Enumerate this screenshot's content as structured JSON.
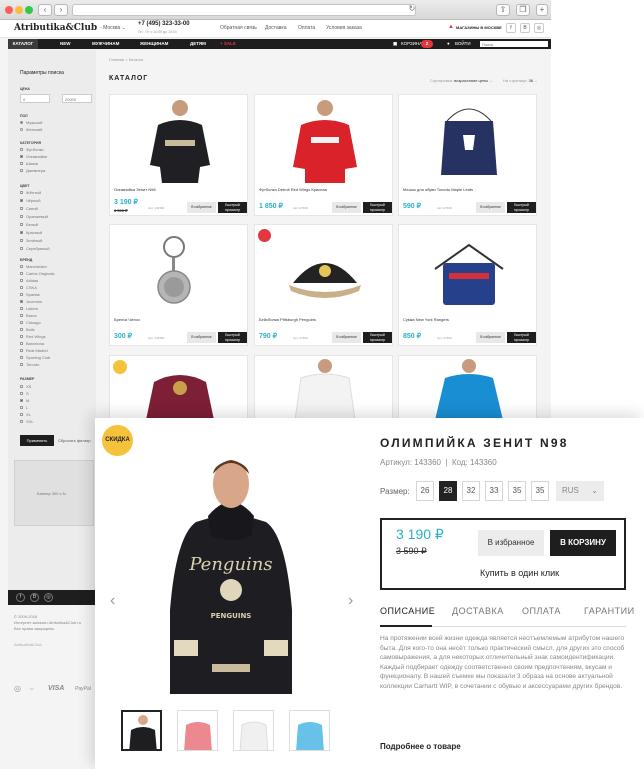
{
  "browser": {
    "address": ""
  },
  "header": {
    "logo": "Atributika&Club",
    "city": "Москва",
    "phone": "+7 (495) 323-33-00",
    "hours": "Пн - Пт с 10:00 до 19:00",
    "links": [
      "Обратная связь",
      "Доставка",
      "Оплата",
      "Условия заказа"
    ],
    "stores": "МАГАЗИНЫ В МОСКВЕ"
  },
  "nav": {
    "items": [
      "КАТАЛОГ",
      "NEW",
      "МУЖЧИНАМ",
      "ЖЕНЩИНАМ",
      "ДЕТЯМ",
      "SALE"
    ],
    "cart_label": "Корзина",
    "cart_count": "2",
    "login": "Войти",
    "search_placeholder": "Поиск"
  },
  "sidebar": {
    "title": "Параметры поиска",
    "price_label": "Цена",
    "price_from": "0",
    "price_to": "20000",
    "sections": [
      {
        "name": "Пол",
        "options": [
          "Мужской",
          "Женский"
        ]
      },
      {
        "name": "Категория",
        "options": [
          "Футболки",
          "Олимпийки",
          "Шапки",
          "Джемпера"
        ]
      },
      {
        "name": "Цвет",
        "options": [
          "Жёлтый",
          "Чёрный",
          "Синий",
          "Оранжевый",
          "Белый",
          "Красный",
          "Зелёный",
          "Серебряный"
        ]
      },
      {
        "name": "Бренд",
        "options": [
          "Manchester",
          "Carlos Originals",
          "Adidas",
          "CSKA",
          "Spartak",
          "Juventus",
          "Lakers",
          "Barca",
          "Chicago",
          "Bulls",
          "Red Wings",
          "Barcelona",
          "Real Madrid",
          "Sporting Club",
          "Toronto"
        ]
      },
      {
        "name": "Размер",
        "options": [
          "XS",
          "S",
          "M",
          "L",
          "XL",
          "XXL"
        ]
      }
    ],
    "apply": "Применить",
    "reset": "Сбросить фильтр",
    "banner": "Баннер 300 x N"
  },
  "footer": {
    "copyright": "© 2009-2016",
    "line1": "Интернет-магазин Atributika&Club.ru",
    "line2": "Все права защищены",
    "payments": [
      "VISA",
      "PayPal"
    ]
  },
  "catalog": {
    "breadcrumb": "Главная > Каталог",
    "title": "КАТАЛОГ",
    "sort_label": "Сортировка:",
    "sort_value": "возрастание цены",
    "per_page_label": "На странице:",
    "per_page_value": "36",
    "fav_label": "В избранное",
    "quick_view": "Быстрый просмотр",
    "products": [
      {
        "name": "Олимпийка Зенит N98",
        "price": "3 190 ₽",
        "old_price": "3 590 ₽",
        "article": "Арт. 143360"
      },
      {
        "name": "Футболка Detroit Red Wings Красная",
        "price": "1 850 ₽",
        "old_price": "",
        "article": "Арт. 27460"
      },
      {
        "name": "Мешок для обуви Toronto Maple Leafs",
        "price": "590 ₽",
        "old_price": "",
        "article": "Арт. 27460"
      },
      {
        "name": "Брелок Челси",
        "price": "300 ₽",
        "old_price": "",
        "article": "Арт. 143360"
      },
      {
        "name": "Бейсболка Pittsburgh Penguins",
        "price": "790 ₽",
        "old_price": "",
        "article": "Арт. 27460"
      },
      {
        "name": "Сумка New York Rangers",
        "price": "850 ₽",
        "old_price": "",
        "article": "Арт. 27460"
      },
      {
        "name": "",
        "price": "",
        "old_price": "",
        "article": ""
      },
      {
        "name": "",
        "price": "",
        "old_price": "",
        "article": ""
      },
      {
        "name": "",
        "price": "",
        "old_price": "",
        "article": ""
      }
    ]
  },
  "product": {
    "badge": "СКИДКА",
    "title": "ОЛИМПИЙКА ЗЕНИТ N98",
    "article": "Артикул: 143360",
    "code": "Код: 143360",
    "size_label": "Размер:",
    "sizes": [
      "26",
      "28",
      "32",
      "33",
      "35",
      "35"
    ],
    "selected_size": "28",
    "size_system": "RUS",
    "price": "3 190 ₽",
    "old_price": "3 590 ₽",
    "fav_button": "В избранное",
    "cart_button": "В КОРЗИНУ",
    "one_click": "Купить в один клик",
    "tabs": [
      "ОПИСАНИЕ",
      "ДОСТАВКА",
      "ОПЛАТА",
      "ГАРАНТИИ"
    ],
    "description": "На протяжении всей жизни одежда является неотъемлемым атрибутом нашего быта. Для кого-то она несёт только практический смысл, для других это способ самовыражения, а для некоторых отличительный знак самоидентификации. Каждый подбирает одежду соответственно своим предпочтениям, вкусам и функционалу. В нашей съемке мы показали 3 образа на основе актуальной коллекции Carhartt WIP, в сочетании с обувью и аксессуарами других брендов.",
    "more": "Подробнее о товаре",
    "hoodie_text": "Penguins",
    "hoodie_team": "PENGUINS"
  },
  "colors": {
    "accent": "#2bb1c6",
    "badge_yellow": "#f5c33b",
    "sale_red": "#e0383e",
    "dark": "#1e1e1e"
  }
}
